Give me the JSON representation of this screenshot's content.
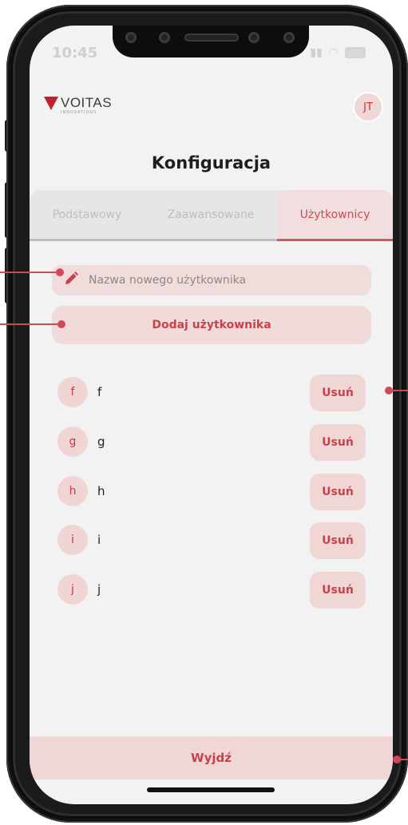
{
  "status_bar": {
    "time": "10:45"
  },
  "header": {
    "logo_text": "VOITAS",
    "logo_subtext": "INNOVATIONS",
    "user_initials": "JT"
  },
  "page": {
    "title": "Konfiguracja"
  },
  "tabs": [
    {
      "label": "Podstawowy",
      "active": false
    },
    {
      "label": "Zaawansowane",
      "active": false
    },
    {
      "label": "Użytkownicy",
      "active": true
    }
  ],
  "new_user": {
    "placeholder": "Nazwa nowego użytkownika",
    "value": "",
    "icon": "pencil-icon",
    "add_label": "Dodaj użytkownika"
  },
  "users": [
    {
      "initial": "f",
      "name": "f",
      "delete_label": "Usuń"
    },
    {
      "initial": "g",
      "name": "g",
      "delete_label": "Usuń"
    },
    {
      "initial": "h",
      "name": "h",
      "delete_label": "Usuń"
    },
    {
      "initial": "i",
      "name": "i",
      "delete_label": "Usuń"
    },
    {
      "initial": "j",
      "name": "j",
      "delete_label": "Usuń"
    }
  ],
  "footer": {
    "exit_label": "Wyjdź"
  },
  "colors": {
    "accent": "#c8424b",
    "accent_soft": "#f1dada",
    "background": "#f2f2f2"
  }
}
